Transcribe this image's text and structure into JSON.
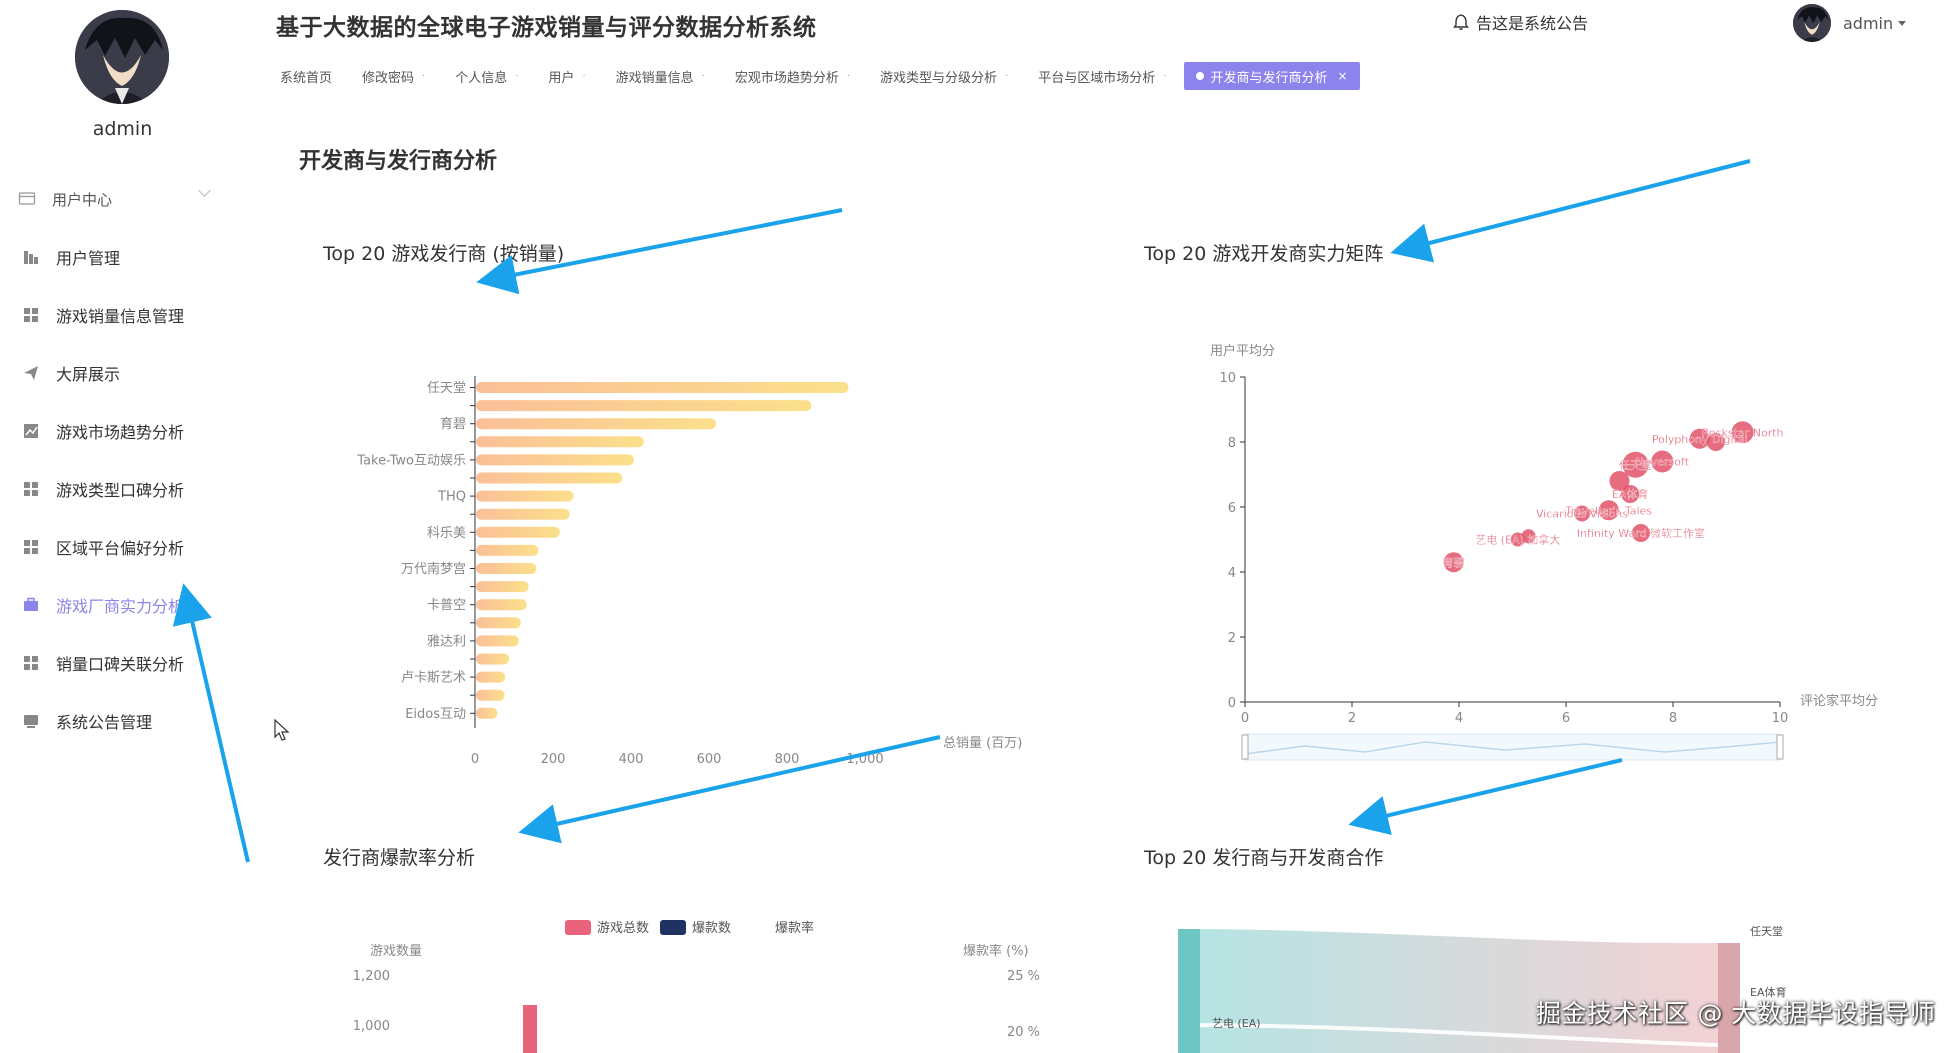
{
  "app": {
    "title": "基于大数据的全球电子游戏销量与评分数据分析系统",
    "notice_label": "告这是系统公告",
    "username": "admin"
  },
  "sidebar": {
    "username": "admin",
    "items": [
      {
        "label": "用户中心",
        "icon": "user-center-icon"
      },
      {
        "label": "用户管理",
        "icon": "chart-bars-icon"
      },
      {
        "label": "游戏销量信息管理",
        "icon": "grid-icon"
      },
      {
        "label": "大屏展示",
        "icon": "send-icon"
      },
      {
        "label": "游戏市场趋势分析",
        "icon": "line-chart-icon"
      },
      {
        "label": "游戏类型口碑分析",
        "icon": "grid-icon"
      },
      {
        "label": "区域平台偏好分析",
        "icon": "grid-icon"
      },
      {
        "label": "游戏厂商实力分析",
        "icon": "briefcase-icon",
        "active": true
      },
      {
        "label": "销量口碑关联分析",
        "icon": "grid-icon"
      },
      {
        "label": "系统公告管理",
        "icon": "monitor-icon"
      }
    ]
  },
  "tabs": [
    {
      "label": "系统首页"
    },
    {
      "label": "修改密码"
    },
    {
      "label": "个人信息"
    },
    {
      "label": "用户"
    },
    {
      "label": "游戏销量信息"
    },
    {
      "label": "宏观市场趋势分析"
    },
    {
      "label": "游戏类型与分级分析"
    },
    {
      "label": "平台与区域市场分析"
    },
    {
      "label": "开发商与发行商分析",
      "active": true
    }
  ],
  "page": {
    "heading": "开发商与发行商分析"
  },
  "charts": {
    "publishers_title": "Top 20 游戏发行商 (按销量)",
    "developers_title": "Top 20 游戏开发商实力矩阵",
    "hit_rate_title": "发行商爆款率分析",
    "sankey_title": "Top 20 发行商与开发商合作"
  },
  "watermark": "掘金技术社区 @ 大数据毕设指导师",
  "colors": {
    "accent": "#8d83ec",
    "arrow": "#1aa3ea",
    "bar_start": "#fbbf98",
    "bar_end": "#fbe08a",
    "scatter": "#e2536a",
    "hit_total": "#e8637b",
    "hit_count": "#1f3264"
  },
  "chart_data": [
    {
      "type": "bar",
      "orientation": "horizontal",
      "title": "Top 20 游戏发行商 (按销量)",
      "xlabel": "总销量 (百万)",
      "xlim": [
        0,
        1000
      ],
      "xticks": [
        "0",
        "200",
        "400",
        "600",
        "800",
        "1,000"
      ],
      "categories": [
        "任天堂",
        "",
        "育碧",
        "",
        "Take-Two互动娱乐",
        "",
        "THQ",
        "",
        "科乐美",
        "",
        "万代南梦宫",
        "",
        "卡普空",
        "",
        "雅达利",
        "",
        "卢卡斯艺术",
        "",
        "Eidos互动"
      ],
      "labels_shown": [
        "任天堂",
        "育碧",
        "Take-Two互动娱乐",
        "THQ",
        "科乐美",
        "万代南梦宫",
        "卡普空",
        "雅达利",
        "卢卡斯艺术",
        "Eidos互动"
      ],
      "values": [
        955,
        860,
        615,
        430,
        405,
        375,
        250,
        240,
        215,
        160,
        155,
        135,
        130,
        115,
        110,
        85,
        75,
        73,
        55
      ]
    },
    {
      "type": "scatter",
      "title": "Top 20 游戏开发商实力矩阵",
      "xlabel": "评论家平均分",
      "ylabel": "用户平均分",
      "xlim": [
        0,
        10
      ],
      "ylim": [
        0,
        10
      ],
      "xticks": [
        "0",
        "2",
        "4",
        "6",
        "8",
        "10"
      ],
      "yticks": [
        "0",
        "2",
        "4",
        "6",
        "8",
        "10"
      ],
      "points": [
        {
          "x": 3.9,
          "y": 4.3,
          "r": 10,
          "label": "育碧"
        },
        {
          "x": 5.1,
          "y": 5.0,
          "r": 7,
          "label": "艺电 (EA) 加拿大"
        },
        {
          "x": 5.3,
          "y": 5.1,
          "r": 7,
          "label": ""
        },
        {
          "x": 7.4,
          "y": 5.2,
          "r": 9,
          "label": "Infinity Ward 微软工作室"
        },
        {
          "x": 6.3,
          "y": 5.8,
          "r": 8,
          "label": "Vicarious Visions"
        },
        {
          "x": 6.8,
          "y": 5.9,
          "r": 10,
          "label": "Traveller's Tales"
        },
        {
          "x": 7.2,
          "y": 6.4,
          "r": 9,
          "label": "EA体育"
        },
        {
          "x": 7.0,
          "y": 6.8,
          "r": 10,
          "label": ""
        },
        {
          "x": 7.3,
          "y": 7.3,
          "r": 13,
          "label": "任天堂"
        },
        {
          "x": 7.8,
          "y": 7.4,
          "r": 11,
          "label": "Neversoft"
        },
        {
          "x": 8.5,
          "y": 8.1,
          "r": 10,
          "label": "Polyphony Digital"
        },
        {
          "x": 9.3,
          "y": 8.3,
          "r": 11,
          "label": "Rockstar North"
        },
        {
          "x": 8.8,
          "y": 8.0,
          "r": 9,
          "label": ""
        }
      ]
    },
    {
      "type": "bar",
      "title": "发行商爆款率分析",
      "legend": [
        "游戏总数",
        "爆款数",
        "爆款率"
      ],
      "ylabel": "游戏数量",
      "ylabel_right": "爆款率 (%)",
      "yticks_left": [
        "1,200",
        "1,000"
      ],
      "yticks_right": [
        "25 %",
        "20 %"
      ],
      "series": [
        {
          "name": "游戏总数",
          "values": [
            1100
          ]
        }
      ]
    },
    {
      "type": "sankey",
      "title": "Top 20 发行商与开发商合作",
      "nodes": [
        "艺电 (EA)",
        "任天堂",
        "EA体育"
      ]
    }
  ]
}
